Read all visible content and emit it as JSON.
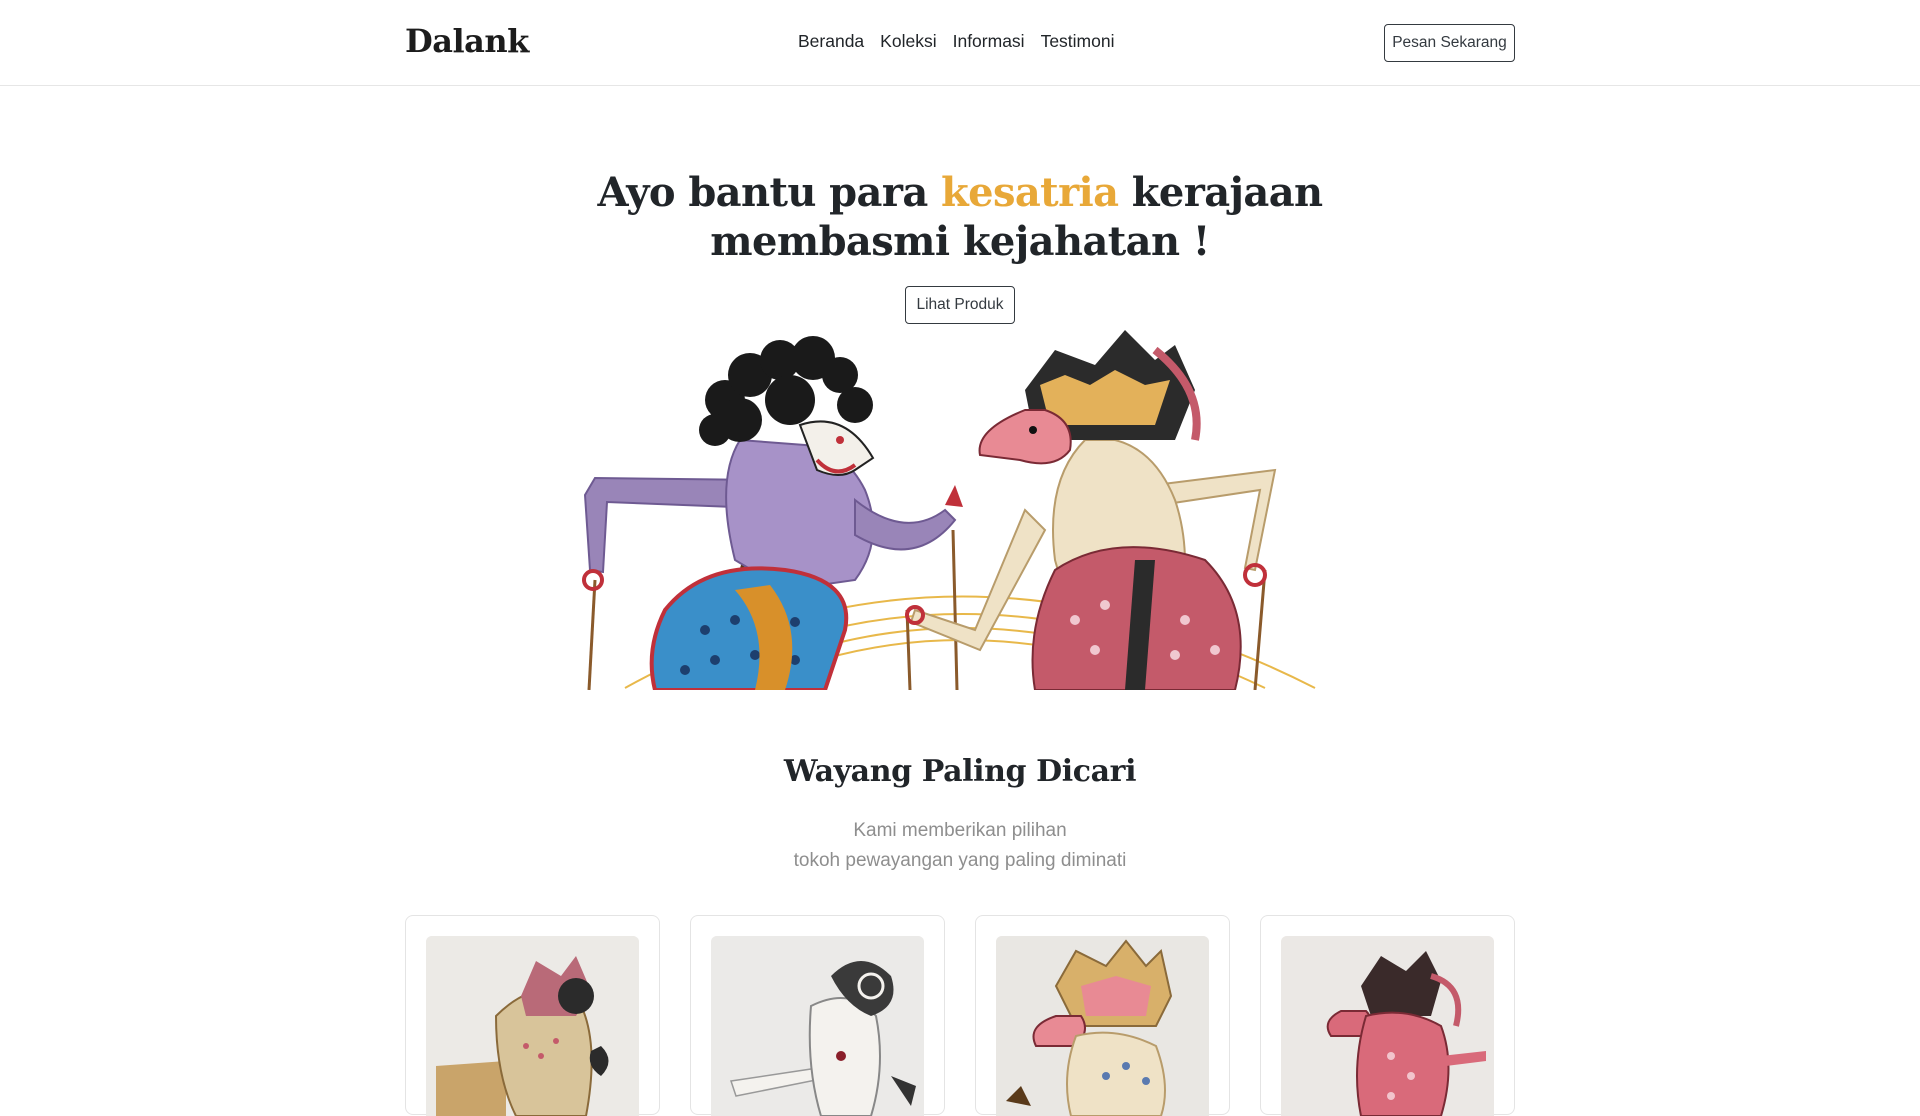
{
  "navbar": {
    "brand": "Dalank",
    "links": [
      "Beranda",
      "Koleksi",
      "Informasi",
      "Testimoni"
    ],
    "order_label": "Pesan Sekarang"
  },
  "hero": {
    "title_prefix": "Ayo bantu para ",
    "title_accent": "kesatria",
    "title_suffix": " kerajaan",
    "title_line2": "membasmi kejahatan !",
    "button_label": "Lihat Produk",
    "illustration": "wayang-duel-illustration"
  },
  "section": {
    "title": "Wayang Paling Dicari",
    "subtitle_line1": "Kami memberikan pilihan",
    "subtitle_line2": "tokoh pewayangan yang paling diminati"
  },
  "products": [
    {
      "image": "wayang-puppet-1"
    },
    {
      "image": "wayang-puppet-2"
    },
    {
      "image": "wayang-puppet-3"
    },
    {
      "image": "wayang-puppet-4"
    }
  ],
  "colors": {
    "accent": "#e8a838",
    "text": "#212529",
    "muted": "#8e8e8e",
    "border": "#e4e4e4"
  }
}
